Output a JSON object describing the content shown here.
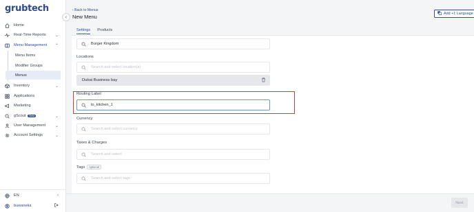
{
  "brand": {
    "logo_text": "grubtech"
  },
  "sidebar": {
    "items": [
      {
        "label": "Home",
        "icon": "home-icon"
      },
      {
        "label": "Real-Time Reports",
        "icon": "activity-icon"
      },
      {
        "label": "Menu Management",
        "icon": "menu-book-icon"
      },
      {
        "label": "Inventory",
        "icon": "box-icon"
      },
      {
        "label": "Applications",
        "icon": "grid-icon"
      },
      {
        "label": "Marketing",
        "icon": "megaphone-icon"
      },
      {
        "label": "gScout",
        "icon": "search-icon",
        "badge": "Beta"
      },
      {
        "label": "User Management",
        "icon": "user-icon"
      },
      {
        "label": "Account Settings",
        "icon": "gear-icon"
      }
    ],
    "sub_items": [
      {
        "label": "Menu Items"
      },
      {
        "label": "Modifier Groups"
      },
      {
        "label": "Menus"
      }
    ],
    "language": "EN",
    "user": "buwaneka"
  },
  "header": {
    "back_label": "Back to Menus",
    "title": "New Menu",
    "language_button": "Add +1 Language"
  },
  "tabs": [
    {
      "label": "Settings",
      "active": true
    },
    {
      "label": "Products",
      "active": false
    }
  ],
  "form": {
    "brand_label": "Brand",
    "brand_value": "Burger Kingdom",
    "locations_label": "Locations",
    "locations_placeholder": "Search and select location(s)",
    "location_selected": "Dubai Business bay",
    "routing_label": "Routing Label",
    "routing_value": "to_kitchen_1",
    "currency_label": "Currency",
    "currency_placeholder": "Search and select currency",
    "taxes_label": "Taxes & Charges",
    "taxes_placeholder": "Search and select",
    "tags_label": "Tags",
    "tags_optional": "optional",
    "tags_placeholder": "Search and select tags"
  },
  "footer": {
    "next_label": "Next"
  },
  "colors": {
    "brand": "#2f4a8f",
    "highlight": "#d33a3a"
  }
}
